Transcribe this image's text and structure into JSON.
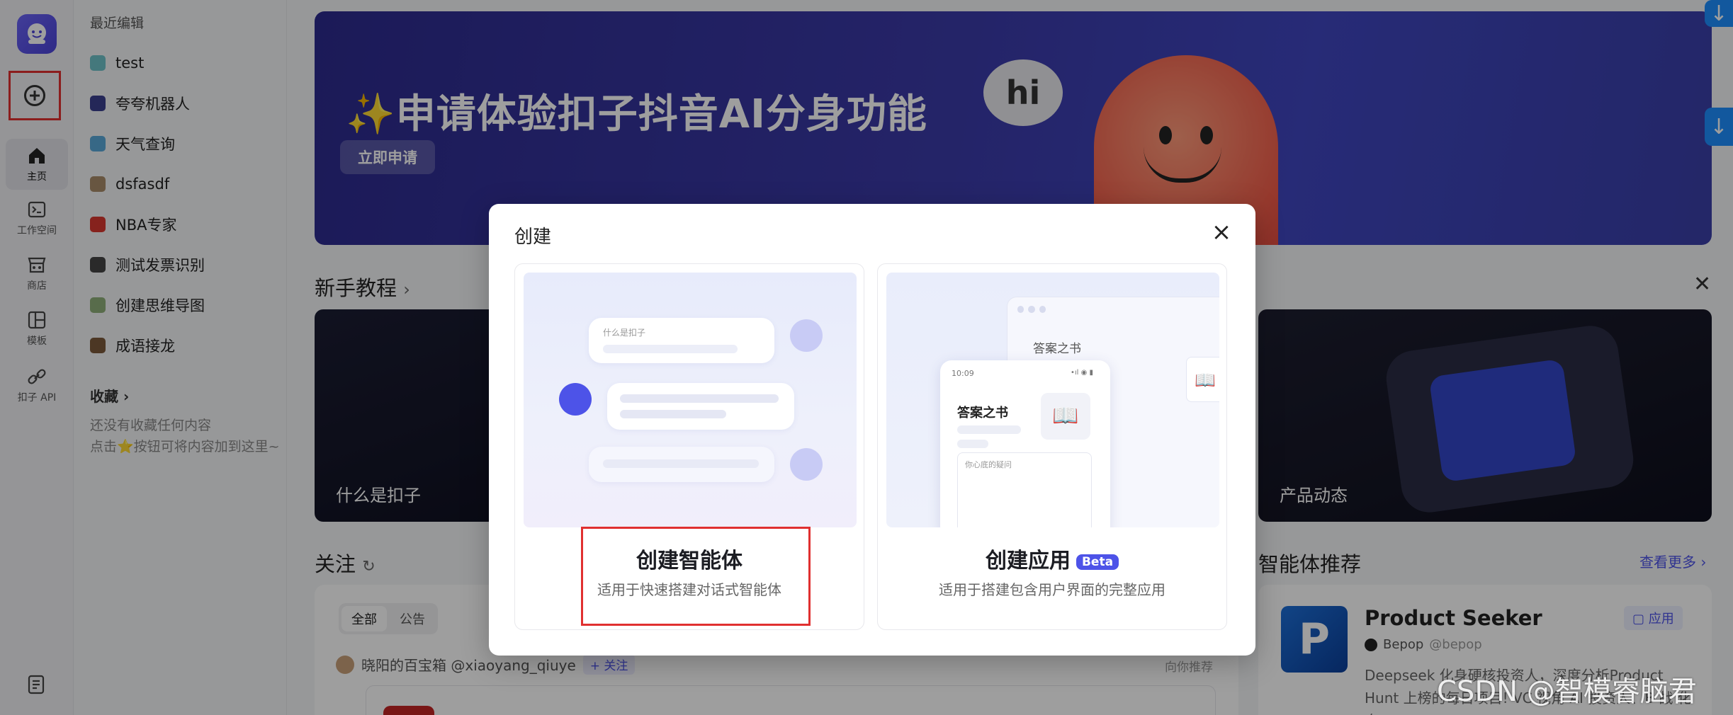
{
  "rail": {
    "items": [
      {
        "label": "主页"
      },
      {
        "label": "工作空间"
      },
      {
        "label": "商店"
      },
      {
        "label": "模板"
      },
      {
        "label": "扣子 API"
      }
    ]
  },
  "sidebar": {
    "recent_heading": "最近编辑",
    "recent_items": [
      {
        "label": "test",
        "color": "#6fc2c9"
      },
      {
        "label": "夸夸机器人",
        "color": "#3b3f8e"
      },
      {
        "label": "天气查询",
        "color": "#5aa9d8"
      },
      {
        "label": "dsfasdf",
        "color": "#a98c6a"
      },
      {
        "label": "NBA专家",
        "color": "#d9372f"
      },
      {
        "label": "测试发票识别",
        "color": "#444444"
      },
      {
        "label": "创建思维导图",
        "color": "#8fae7a"
      },
      {
        "label": "成语接龙",
        "color": "#7b5a3a"
      }
    ],
    "favorites_heading": "收藏",
    "favorites_empty": "还没有收藏任何内容\n点击⭐按钮可将内容加到这里~"
  },
  "banner": {
    "title": "✨申请体验扣子抖音AI分身功能",
    "button": "立即申请",
    "bubble": "hi"
  },
  "tutorial": {
    "heading": "新手教程",
    "cards": [
      {
        "caption": "什么是扣子"
      },
      {
        "caption": "产品动态"
      }
    ]
  },
  "follow": {
    "heading": "关注",
    "tabs": [
      "全部",
      "公告"
    ],
    "feed_author": "晓阳的百宝箱 @xiaoyang_qiuye",
    "follow_btn": "+ 关注",
    "recommend_tag": "向你推荐"
  },
  "recommend": {
    "heading": "智能体推荐",
    "more": "查看更多",
    "name": "Product Seeker",
    "author": "Bepop",
    "handle": "@bepop",
    "badge": "应用",
    "desc": "Deepseek 化身硬核投资人，深度分析Product Hunt 上榜的每日项目! VC 视角 AI 投资人、B 战 化身..."
  },
  "watermark": "CSDN @智模睿脑君",
  "modal": {
    "title": "创建",
    "options": [
      {
        "title": "创建智能体",
        "subtitle": "适用于快速搭建对话式智能体",
        "preview_text": "什么是扣子"
      },
      {
        "title": "创建应用",
        "beta": "Beta",
        "subtitle": "适用于搭建包含用户界面的完整应用",
        "preview_title": "答案之书",
        "preview_title2": "答案之书",
        "preview_time": "10:09",
        "preview_input": "你心底的疑问"
      }
    ]
  }
}
